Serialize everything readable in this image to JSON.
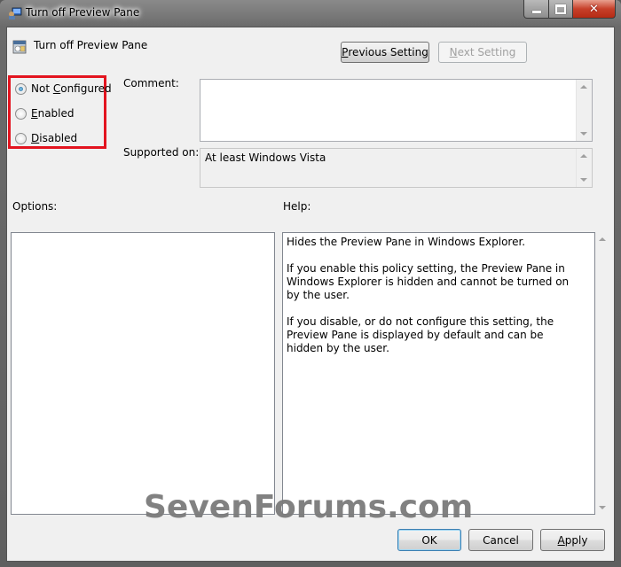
{
  "window": {
    "title": "Turn off Preview Pane",
    "controls": {
      "minimize": "—",
      "maximize": "□",
      "close": "✕"
    }
  },
  "header": {
    "policy_name": "Turn off Preview Pane",
    "previous_setting": {
      "prefix": "P",
      "rest": "revious Setting",
      "enabled": true
    },
    "next_setting": {
      "prefix": "N",
      "rest": "ext Setting",
      "enabled": false
    }
  },
  "state_options": [
    {
      "label_pre": "Not ",
      "accel": "C",
      "label_post": "onfigured",
      "selected": true
    },
    {
      "label_pre": "",
      "accel": "E",
      "label_post": "nabled",
      "selected": false
    },
    {
      "label_pre": "",
      "accel": "D",
      "label_post": "isabled",
      "selected": false
    }
  ],
  "comment": {
    "label": "Comment:",
    "value": ""
  },
  "supported_on": {
    "label": "Supported on:",
    "value": "At least Windows Vista"
  },
  "options": {
    "label": "Options:"
  },
  "help": {
    "label": "Help:",
    "paragraphs": [
      "Hides the Preview Pane in Windows Explorer.",
      "If you enable this policy setting, the Preview Pane in Windows Explorer is hidden and cannot be turned on by the user.",
      "If you disable, or do not configure this setting, the Preview Pane is displayed by default and can be hidden by the user."
    ]
  },
  "footer": {
    "ok": "OK",
    "cancel": "Cancel",
    "apply_accel": "A",
    "apply_rest": "pply"
  },
  "watermark": "SevenForums.com",
  "colors": {
    "highlight": "#e3141f",
    "accent": "#3c7fb1"
  }
}
